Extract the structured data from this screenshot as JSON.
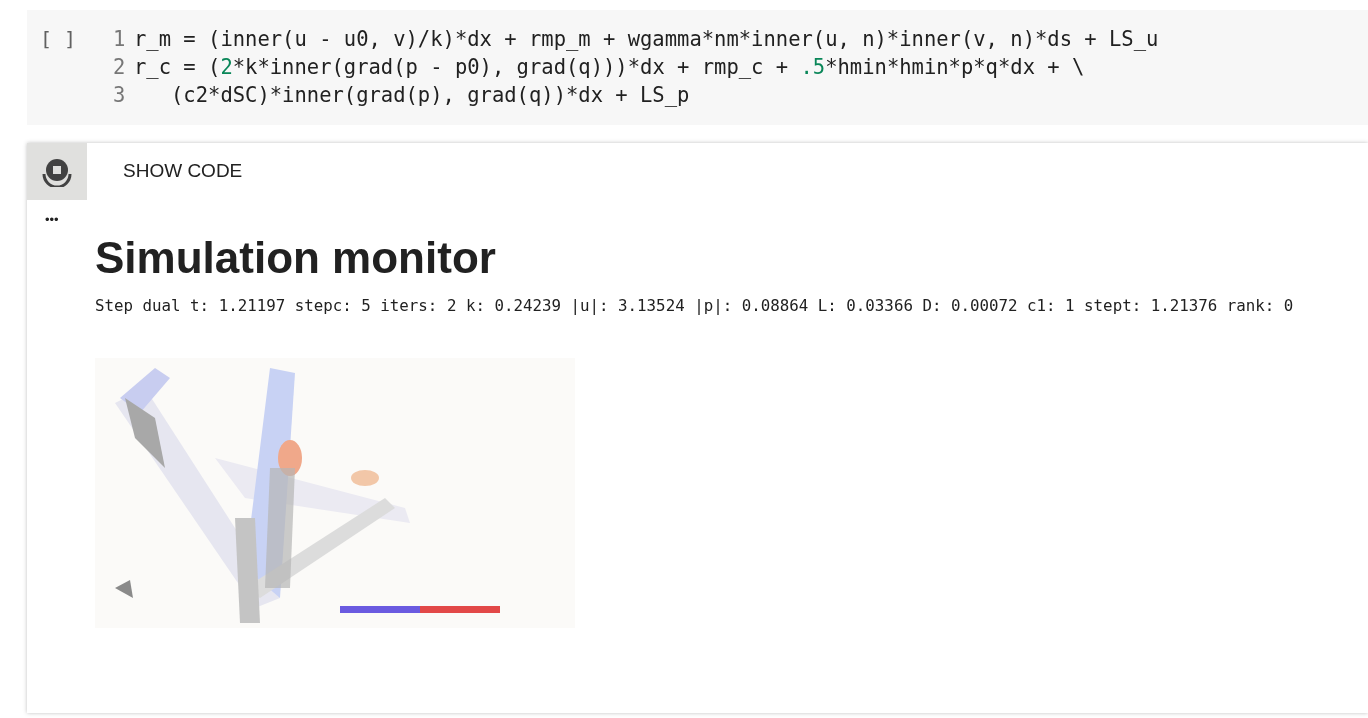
{
  "code_cell": {
    "run_marker": "[ ]",
    "lines": [
      {
        "number": "1",
        "segments": [
          {
            "kind": "plain",
            "text": "r_m = (inner(u - u0, v)/k)*dx + rmp_m + wgamma*nm*inner(u, n)*inner(v, n)*ds + LS_u"
          }
        ]
      },
      {
        "number": "2",
        "segments": [
          {
            "kind": "plain",
            "text": "r_c = ("
          },
          {
            "kind": "number",
            "text": "2"
          },
          {
            "kind": "plain",
            "text": "*k*inner(grad(p - p0), grad(q)))*dx + rmp_c + "
          },
          {
            "kind": "number",
            "text": ".5"
          },
          {
            "kind": "plain",
            "text": "*hmin*hmin*p*q*dx + \\"
          }
        ]
      },
      {
        "number": "3",
        "segments": [
          {
            "kind": "plain",
            "text": "   (c2*dSC)*inner(grad(p), grad(q))*dx + LS_p"
          }
        ]
      }
    ]
  },
  "output_cell": {
    "show_code": "SHOW CODE",
    "more": "•••",
    "heading": "Simulation monitor",
    "status": "Step dual t: 1.21197 stepc: 5 iters: 2 k: 0.24239 |u|: 3.13524 |p|: 0.08864 L: 0.03366 D: 0.00072 c1: 1 stept: 1.21376 rank: 0"
  }
}
